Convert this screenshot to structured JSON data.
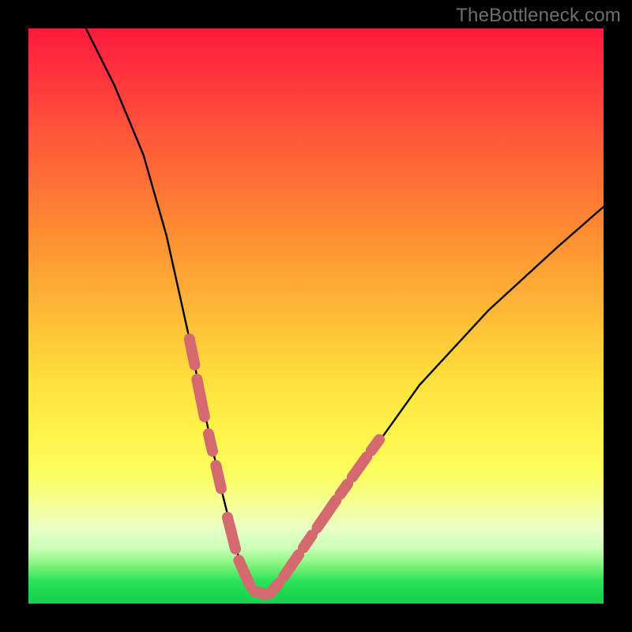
{
  "watermark": "TheBottleneck.com",
  "colors": {
    "frame": "#000000",
    "curve": "#000000",
    "marker": "#d46a6f"
  },
  "chart_data": {
    "type": "line",
    "title": "",
    "xlabel": "",
    "ylabel": "",
    "xlim": [
      0,
      100
    ],
    "ylim": [
      0,
      100
    ],
    "grid": false,
    "legend": false,
    "series": [
      {
        "name": "curve",
        "x": [
          10,
          15,
          20,
          24,
          26,
          28,
          30,
          32,
          33.5,
          35,
          36,
          37,
          38,
          39,
          40.5,
          42,
          45,
          50,
          58,
          68,
          80,
          92,
          100
        ],
        "y": [
          100,
          90,
          78,
          64,
          55,
          46,
          36,
          27,
          20,
          14,
          10,
          6.5,
          4,
          2.5,
          1.5,
          1.5,
          5,
          12,
          24,
          38,
          51,
          62,
          69
        ]
      }
    ],
    "markers": [
      {
        "name": "left-dashes",
        "segments": [
          {
            "x1": 28.0,
            "y1": 46.0,
            "x2": 28.9,
            "y2": 41.5
          },
          {
            "x1": 29.3,
            "y1": 39.0,
            "x2": 30.6,
            "y2": 32.5
          },
          {
            "x1": 31.3,
            "y1": 29.5,
            "x2": 32.0,
            "y2": 26.5
          },
          {
            "x1": 32.6,
            "y1": 24.0,
            "x2": 33.5,
            "y2": 20.0
          },
          {
            "x1": 34.6,
            "y1": 15.0,
            "x2": 36.0,
            "y2": 9.5
          },
          {
            "x1": 36.6,
            "y1": 7.5,
            "x2": 38.5,
            "y2": 3.2
          },
          {
            "x1": 39.2,
            "y1": 2.2,
            "x2": 41.2,
            "y2": 1.6
          },
          {
            "x1": 42.0,
            "y1": 1.8,
            "x2": 43.6,
            "y2": 3.6
          }
        ]
      },
      {
        "name": "right-dashes",
        "segments": [
          {
            "x1": 44.4,
            "y1": 4.7,
            "x2": 47.0,
            "y2": 8.5
          },
          {
            "x1": 47.8,
            "y1": 9.7,
            "x2": 49.3,
            "y2": 11.9
          },
          {
            "x1": 50.2,
            "y1": 13.2,
            "x2": 53.5,
            "y2": 18.0
          },
          {
            "x1": 54.2,
            "y1": 19.0,
            "x2": 55.5,
            "y2": 20.8
          },
          {
            "x1": 56.3,
            "y1": 22.0,
            "x2": 58.8,
            "y2": 25.5
          },
          {
            "x1": 59.6,
            "y1": 26.6,
            "x2": 61.0,
            "y2": 28.5
          }
        ]
      }
    ]
  }
}
